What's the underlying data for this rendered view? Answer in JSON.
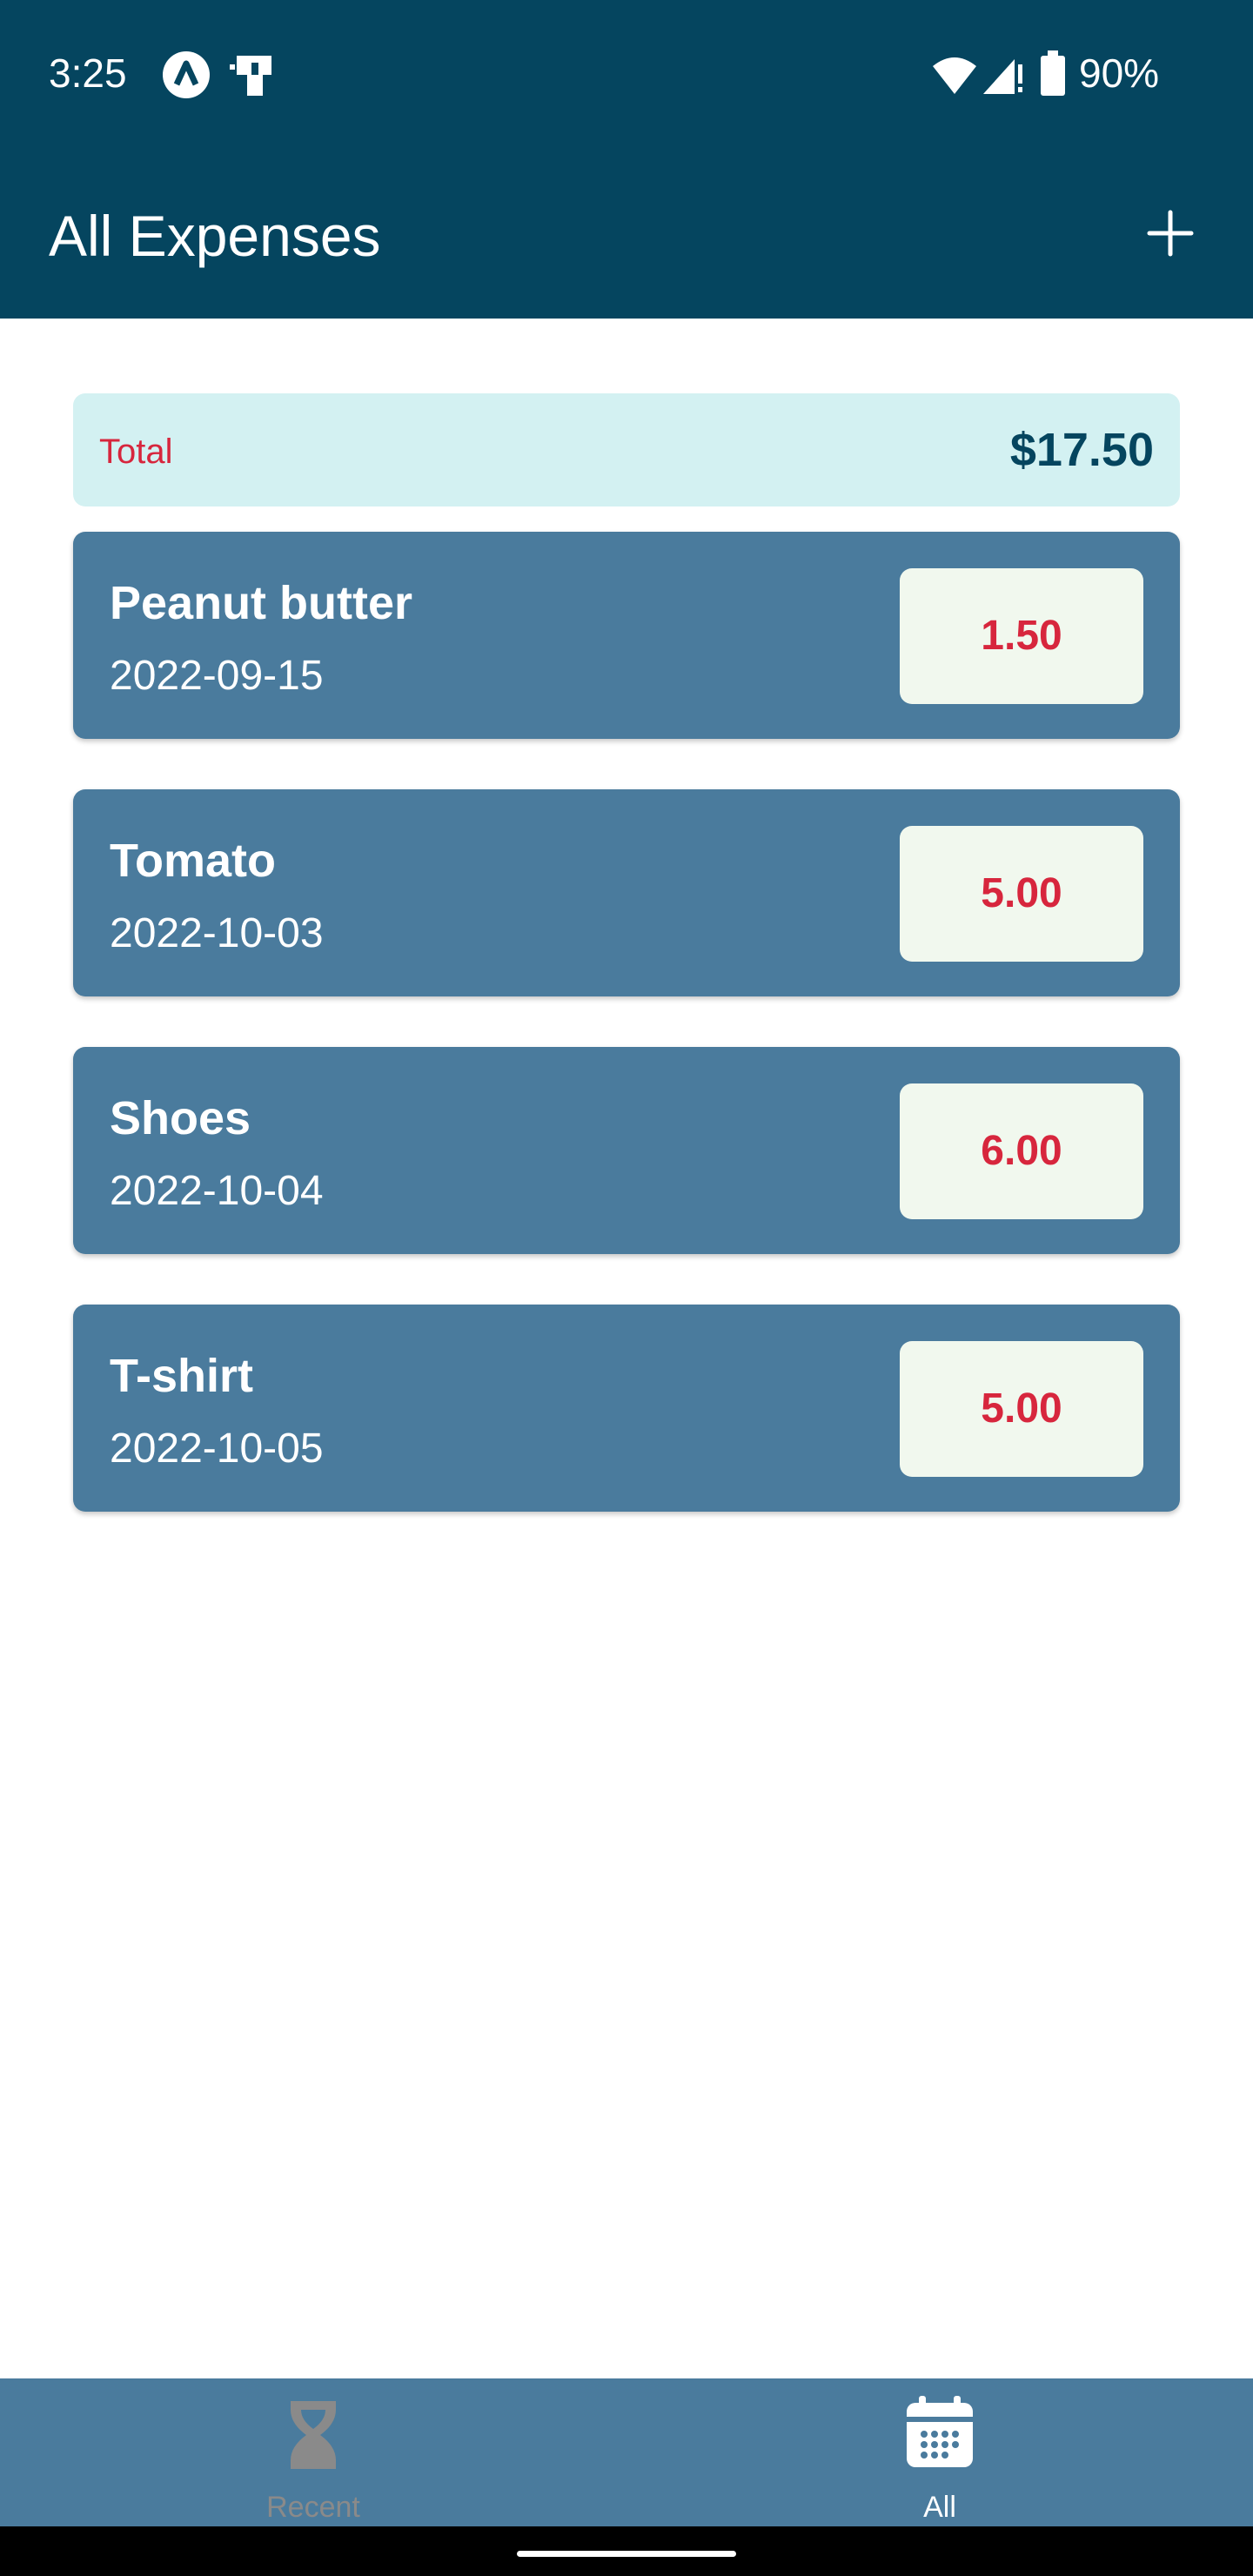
{
  "status_bar": {
    "time": "3:25",
    "battery": "90%",
    "icons": [
      "app-a-icon",
      "bag-icon",
      "wifi-icon",
      "signal-icon",
      "battery-icon"
    ]
  },
  "header": {
    "title": "All Expenses",
    "add_icon": "plus-icon"
  },
  "summary": {
    "label": "Total",
    "amount": "$17.50"
  },
  "expenses": [
    {
      "description": "Peanut butter",
      "date": "2022-09-15",
      "amount": "1.50"
    },
    {
      "description": "Tomato",
      "date": "2022-10-03",
      "amount": "5.00"
    },
    {
      "description": "Shoes",
      "date": "2022-10-04",
      "amount": "6.00"
    },
    {
      "description": "T-shirt",
      "date": "2022-10-05",
      "amount": "5.00"
    }
  ],
  "tabs": [
    {
      "label": "Recent",
      "icon": "hourglass-icon",
      "active": false
    },
    {
      "label": "All",
      "icon": "calendar-icon",
      "active": true
    }
  ],
  "colors": {
    "header_bg": "#05455f",
    "card_bg": "#4a7b9d",
    "amount_red": "#d7263d",
    "total_bg": "#d3f1f2",
    "amount_box_bg": "#f1f8ee",
    "tab_active": "#ffffff",
    "tab_inactive": "#8a8a8a"
  }
}
